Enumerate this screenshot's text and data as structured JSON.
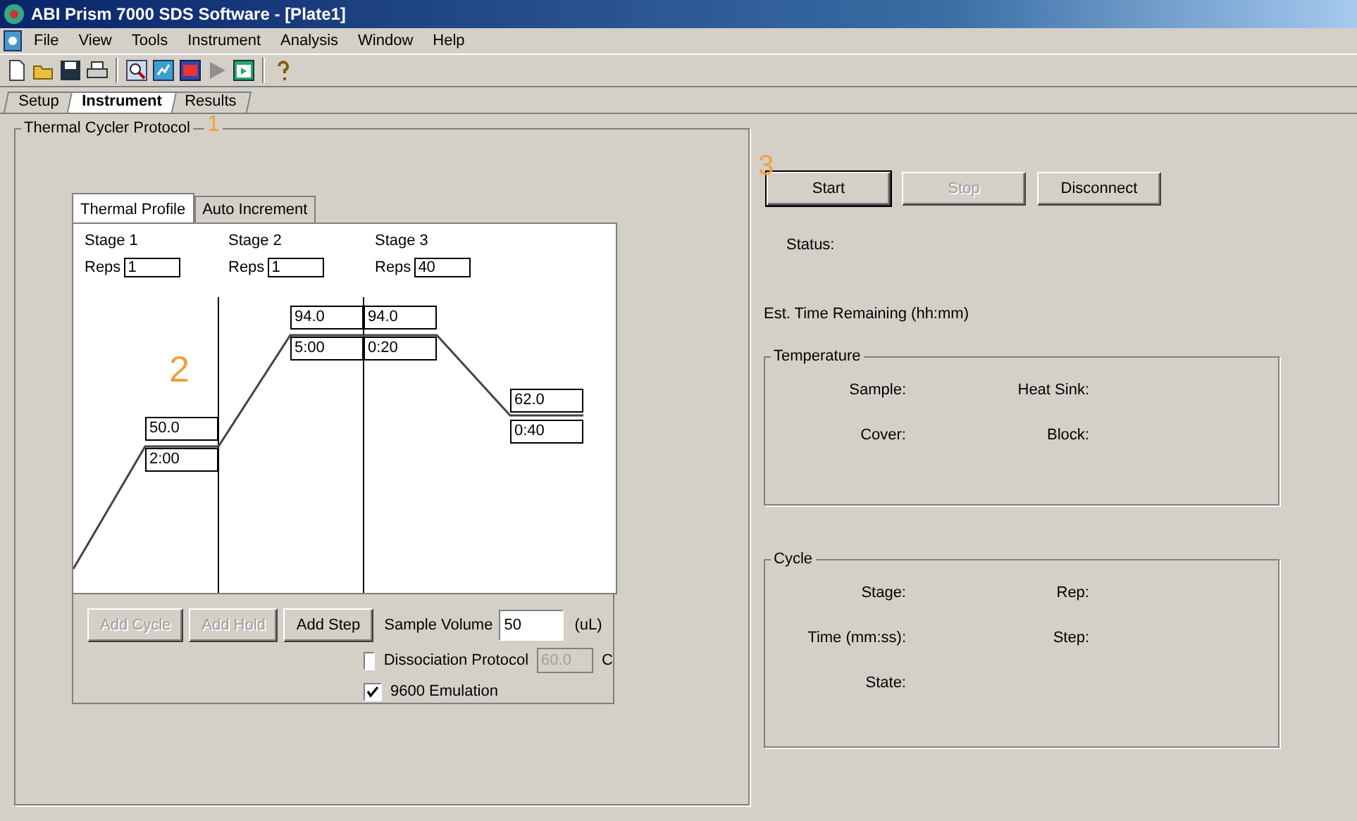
{
  "window": {
    "title": "ABI Prism 7000 SDS Software - [Plate1]"
  },
  "menu": [
    "File",
    "View",
    "Tools",
    "Instrument",
    "Analysis",
    "Window",
    "Help"
  ],
  "tabs": [
    {
      "label": "Setup",
      "selected": false
    },
    {
      "label": "Instrument",
      "selected": true
    },
    {
      "label": "Results",
      "selected": false
    }
  ],
  "tabs_annotation": "1",
  "protocol": {
    "title": "Thermal Cycler Protocol",
    "annotation": "2",
    "tabs": [
      {
        "label": "Thermal Profile",
        "selected": true
      },
      {
        "label": "Auto Increment",
        "selected": false
      }
    ],
    "stages": [
      {
        "label": "Stage 1",
        "reps_label": "Reps",
        "reps": "1",
        "steps": [
          {
            "temperature": "50.0",
            "time": "2:00"
          }
        ]
      },
      {
        "label": "Stage 2",
        "reps_label": "Reps",
        "reps": "1",
        "steps": [
          {
            "temperature": "94.0",
            "time": "5:00"
          }
        ]
      },
      {
        "label": "Stage 3",
        "reps_label": "Reps",
        "reps": "40",
        "steps": [
          {
            "temperature": "94.0",
            "time": "0:20"
          },
          {
            "temperature": "62.0",
            "time": "0:40"
          }
        ]
      }
    ],
    "buttons": [
      {
        "label": "Add Cycle",
        "disabled": true
      },
      {
        "label": "Add Hold",
        "disabled": true
      },
      {
        "label": "Add Step",
        "disabled": false
      }
    ],
    "sample_volume": {
      "label": "Sample Volume",
      "value": "50",
      "unit": "(uL)"
    },
    "options": [
      {
        "label": "Dissociation Protocol",
        "checked": false,
        "value": "60.0",
        "unit": "C",
        "field_disabled": true
      },
      {
        "label": "9600 Emulation",
        "checked": true
      }
    ]
  },
  "run": {
    "annotation": "3",
    "buttons": [
      {
        "label": "Start",
        "disabled": false,
        "default": true
      },
      {
        "label": "Stop",
        "disabled": true,
        "default": false
      },
      {
        "label": "Disconnect",
        "disabled": false,
        "default": false
      }
    ],
    "status_label": "Status:",
    "time_label": "Est. Time Remaining (hh:mm)",
    "temperature": {
      "title": "Temperature",
      "items": [
        "Sample:",
        "Heat Sink:",
        "Cover:",
        "Block:"
      ]
    },
    "cycle": {
      "title": "Cycle",
      "items": [
        "Stage:",
        "Rep:",
        "Time (mm:ss):",
        "Step:",
        "State:"
      ]
    }
  }
}
